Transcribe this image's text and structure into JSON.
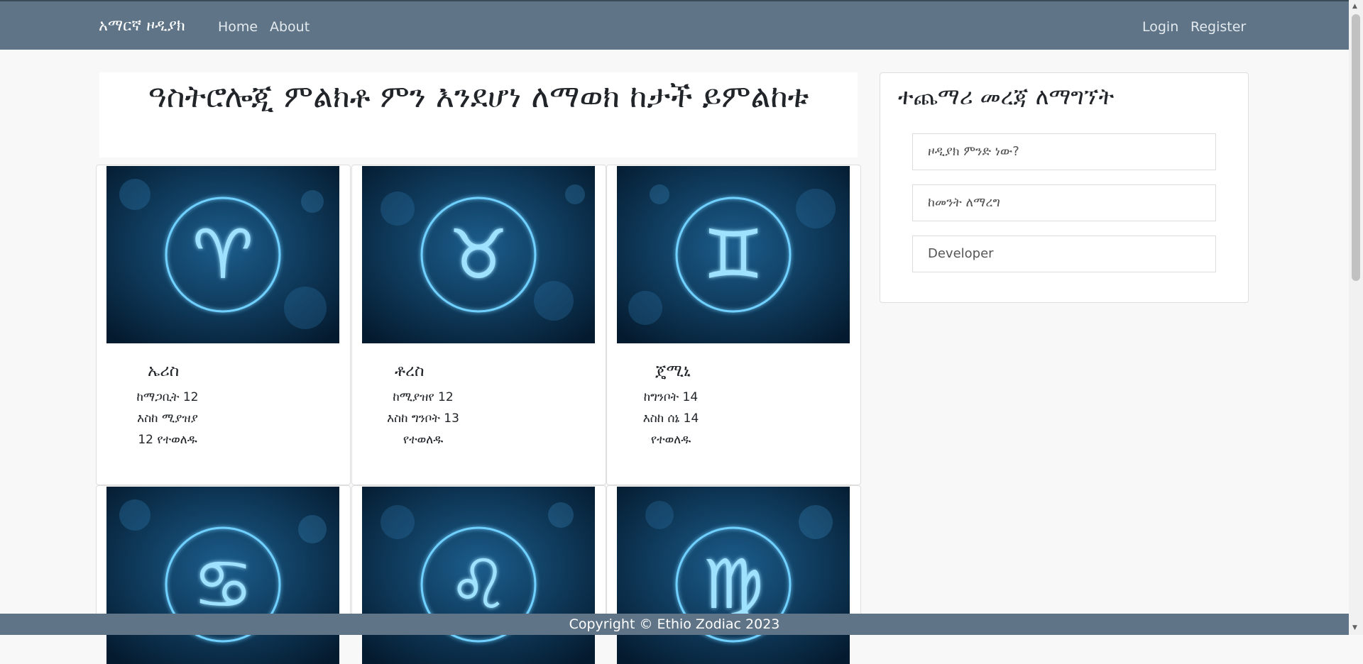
{
  "nav": {
    "brand": "አማርኛ ዞዲያክ",
    "home": "Home",
    "about": "About",
    "login": "Login",
    "register": "Register"
  },
  "main": {
    "title": "ዓስትሮሎጂ ምልክቶ ምን እንደሆነ ለማወክ ከታች ይምልከቱ"
  },
  "cards": [
    {
      "name": "ኤሪስ",
      "line1": "ከማጋቢት 12",
      "line2": "እስከ ሚያዝያ",
      "line3": "12 የተወለዱ",
      "icon": "aries-icon",
      "glyph": "♈"
    },
    {
      "name": "ቶረስ",
      "line1": "ከሚያዝየ 12",
      "line2": "እስከ ግንቦት 13",
      "line3": "የተወለዱ",
      "icon": "taurus-icon",
      "glyph": "♉"
    },
    {
      "name": "ጄሚኒ",
      "line1": "ከግንቦት 14",
      "line2": "እስከ ሰኔ 14",
      "line3": "የተወለዱ",
      "icon": "gemini-icon",
      "glyph": "♊"
    },
    {
      "icon": "cancer-icon",
      "glyph": "♋"
    },
    {
      "icon": "leo-icon",
      "glyph": "♌"
    },
    {
      "icon": "virgo-icon",
      "glyph": "♍"
    }
  ],
  "sidebar": {
    "title": "ተጨማሪ መረጃ ለማግኘት",
    "items": [
      "ዞዲያክ ምንድ ነው?",
      "ከመንት ለማረግ",
      "Developer"
    ]
  },
  "footer": {
    "text": "Copyright © Ethio Zodiac 2023"
  },
  "colors": {
    "navbar": "#5f7587",
    "glow": "#6fd0ff",
    "card_bg": "#082845"
  }
}
